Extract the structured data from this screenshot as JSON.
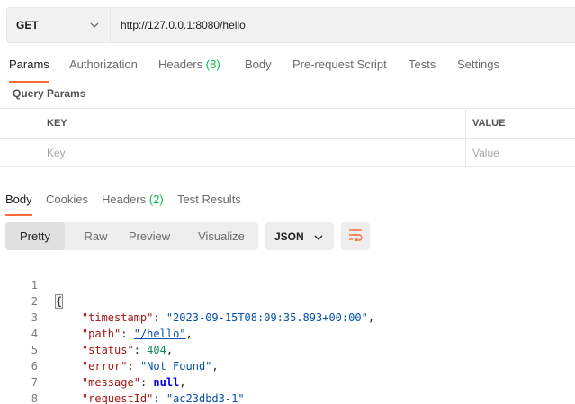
{
  "request": {
    "method": "GET",
    "url": "http://127.0.0.1:8080/hello"
  },
  "request_tabs": [
    {
      "label": "Params"
    },
    {
      "label": "Authorization"
    },
    {
      "label": "Headers",
      "count": "(8)"
    },
    {
      "label": "Body"
    },
    {
      "label": "Pre-request Script"
    },
    {
      "label": "Tests"
    },
    {
      "label": "Settings"
    }
  ],
  "query_params": {
    "title": "Query Params",
    "columns": {
      "key": "KEY",
      "value": "VALUE"
    },
    "placeholders": {
      "key": "Key",
      "value": "Value"
    }
  },
  "response_tabs": [
    {
      "label": "Body"
    },
    {
      "label": "Cookies"
    },
    {
      "label": "Headers",
      "count": "(2)"
    },
    {
      "label": "Test Results"
    }
  ],
  "view_modes": [
    "Pretty",
    "Raw",
    "Preview",
    "Visualize"
  ],
  "format": "JSON",
  "code": {
    "line_numbers": [
      "1",
      "2",
      "3",
      "4",
      "5",
      "6",
      "7",
      "8"
    ],
    "open_brace": "{",
    "close_brace": "}",
    "fields": [
      {
        "key": "\"timestamp\"",
        "value": "\"2023-09-15T08:09:35.893+00:00\""
      },
      {
        "key": "\"path\"",
        "value": "\"/hello\""
      },
      {
        "key": "\"status\"",
        "value": "404"
      },
      {
        "key": "\"error\"",
        "value": "\"Not Found\""
      },
      {
        "key": "\"message\"",
        "value": "null"
      },
      {
        "key": "\"requestId\"",
        "value": "\"ac23dbd3-1\""
      }
    ]
  },
  "colors": {
    "accent": "#ff6c37",
    "count_green": "#0cbb52"
  }
}
